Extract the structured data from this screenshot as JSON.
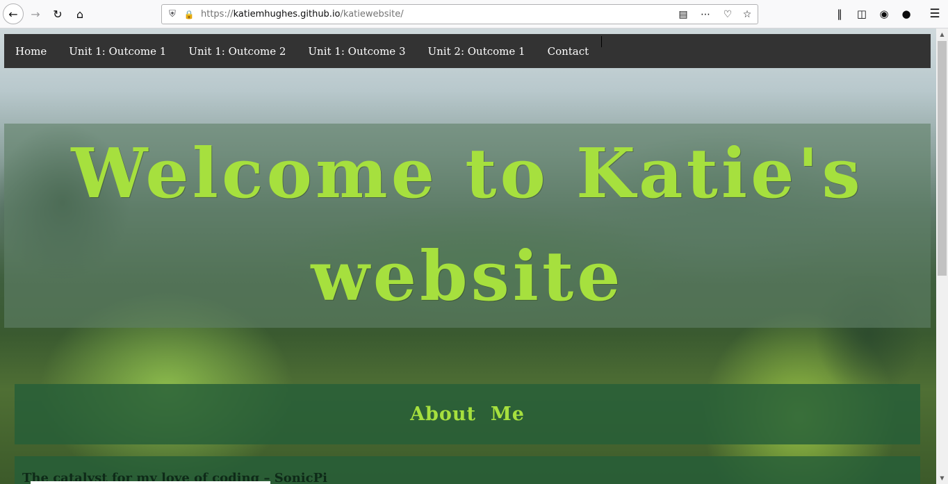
{
  "browser": {
    "url_scheme": "https://",
    "url_host": "katiemhughes.github.io",
    "url_path": "/katiewebsite/",
    "icons": [
      "back-icon",
      "forward-icon",
      "reload-icon",
      "home-icon",
      "shield-icon",
      "lock-icon",
      "reader-view-icon",
      "more-icon",
      "pocket-icon",
      "bookmark-star-icon",
      "library-icon",
      "sidebar-icon",
      "account-icon",
      "extension-icon",
      "menu-icon"
    ]
  },
  "nav": {
    "items": [
      "Home",
      "Unit 1: Outcome 1",
      "Unit 1: Outcome 2",
      "Unit 1: Outcome 3",
      "Unit 2: Outcome 1",
      "Contact"
    ]
  },
  "hero": {
    "title": "Welcome to Katie's website"
  },
  "about": {
    "title": "About  Me"
  },
  "content": {
    "heading": "The catalyst for my love of coding – SonicPi"
  },
  "colors": {
    "nav_bg": "#333333",
    "accent_green": "#a6e03e",
    "panel_green": "#265e38"
  }
}
